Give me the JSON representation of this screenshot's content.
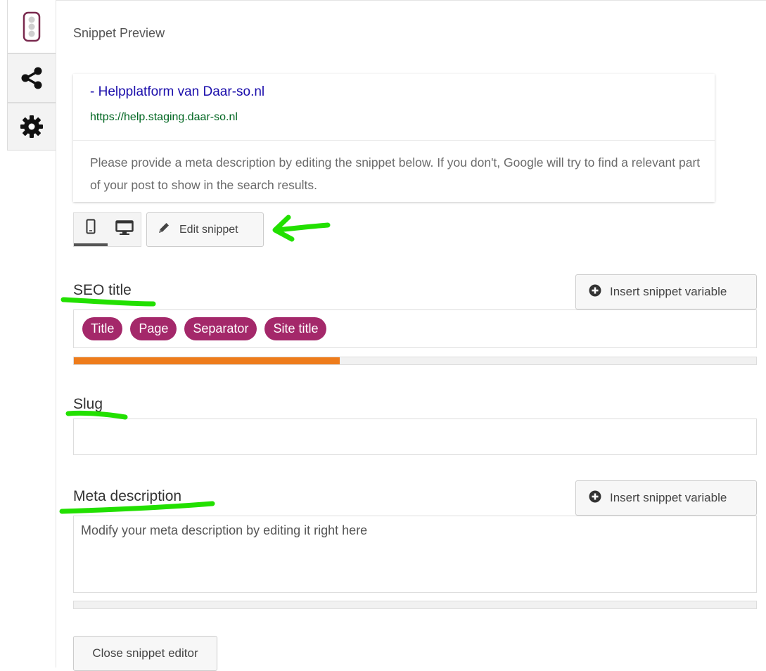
{
  "sidebar": {
    "tabs": [
      {
        "icon": "traffic-light-icon",
        "active": true
      },
      {
        "icon": "share-icon",
        "active": false
      },
      {
        "icon": "gear-icon",
        "active": false
      }
    ]
  },
  "snippet_preview": {
    "heading": "Snippet Preview",
    "title": "- Helpplatform van Daar-so.nl",
    "url": "https://help.staging.daar-so.nl",
    "description": "Please provide a meta description by editing the snippet below. If you don't, Google will try to find a relevant part of your post to show in the search results."
  },
  "toolbar": {
    "mode_selected": "mobile",
    "edit_label": "Edit snippet"
  },
  "seo_title": {
    "label": "SEO title",
    "insert_label": "Insert snippet variable",
    "variables": [
      "Title",
      "Page",
      "Separator",
      "Site title"
    ],
    "progress_percent": 39
  },
  "slug": {
    "label": "Slug",
    "value": ""
  },
  "meta_description": {
    "label": "Meta description",
    "insert_label": "Insert snippet variable",
    "placeholder": "Modify your meta description by editing it right here",
    "progress_percent": 0
  },
  "footer": {
    "close_label": "Close snippet editor"
  },
  "colors": {
    "pill": "#a4286a",
    "progress": "#ee7c1b",
    "annotation": "#22e000",
    "link_title": "#1a0dab",
    "link_url": "#006621"
  }
}
